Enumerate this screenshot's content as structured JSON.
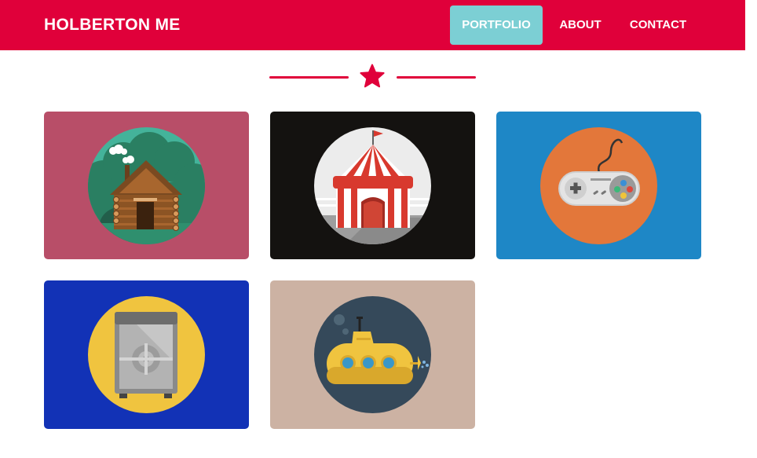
{
  "brand": {
    "name": "HOLBERTON ME"
  },
  "nav": {
    "items": [
      {
        "label": "PORTFOLIO",
        "active": true
      },
      {
        "label": "ABOUT",
        "active": false
      },
      {
        "label": "CONTACT",
        "active": false
      }
    ]
  },
  "divider": {
    "icon": "star-icon"
  },
  "portfolio": {
    "items": [
      {
        "icon": "log-cabin-icon",
        "background": "#b84e68"
      },
      {
        "icon": "circus-tent-icon",
        "background": "#141210"
      },
      {
        "icon": "game-controller-icon",
        "background": "#1e87c6"
      },
      {
        "icon": "safe-icon",
        "background": "#1232b6"
      },
      {
        "icon": "submarine-icon",
        "background": "#ccb2a3"
      }
    ]
  },
  "colors": {
    "primary": "#e0003a",
    "accent": "#7ccfd4"
  }
}
